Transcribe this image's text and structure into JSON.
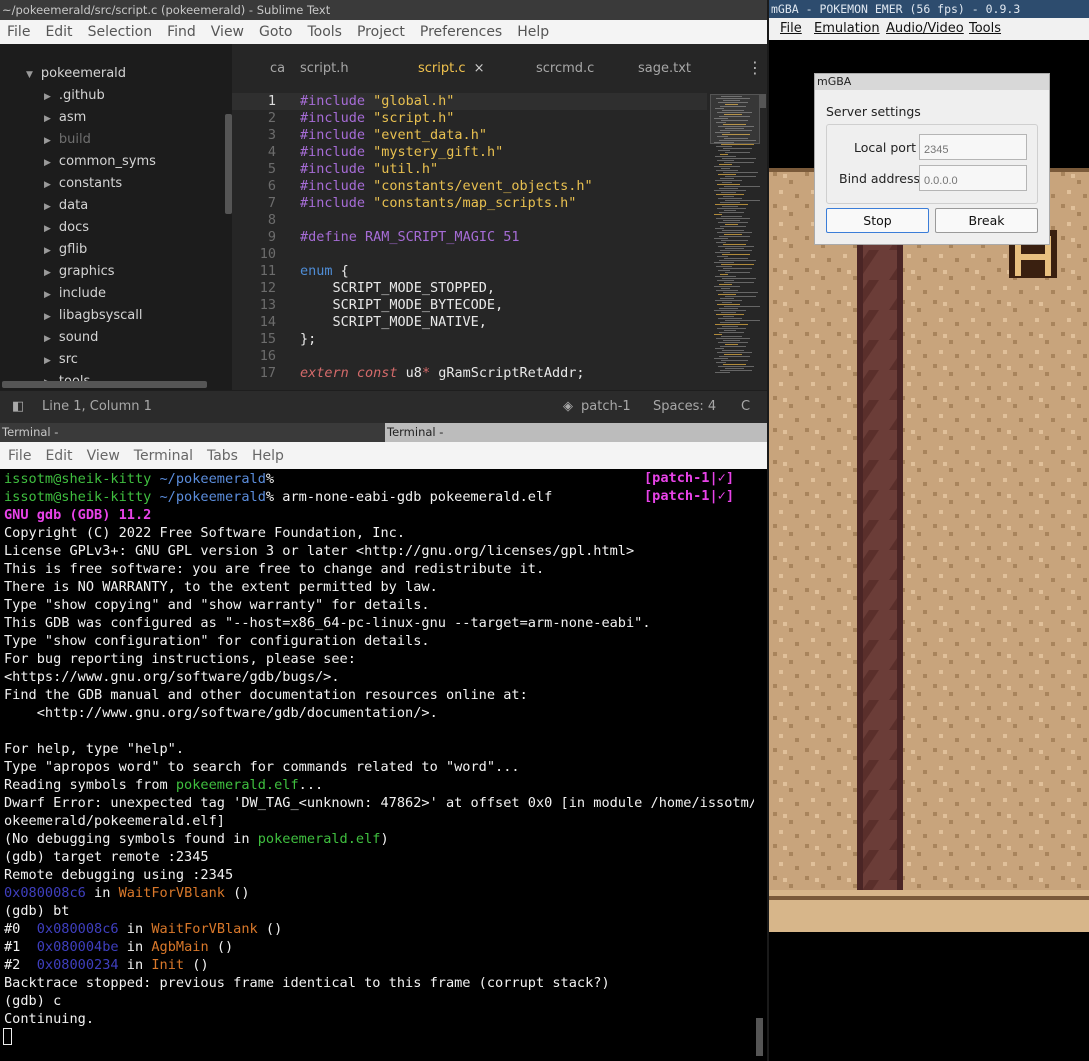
{
  "sublime": {
    "title": "~/pokeemerald/src/script.c (pokeemerald) - Sublime Text",
    "menu": [
      "File",
      "Edit",
      "Selection",
      "Find",
      "View",
      "Goto",
      "Tools",
      "Project",
      "Preferences",
      "Help"
    ],
    "sidebar": {
      "root": "pokeemerald",
      "folders": [
        ".github",
        "asm",
        "build",
        "common_syms",
        "constants",
        "data",
        "docs",
        "gflib",
        "graphics",
        "include",
        "libagbsyscall",
        "sound",
        "src",
        "tools"
      ]
    },
    "tabs": [
      "ca",
      "script.h",
      "script.c",
      "scrcmd.c",
      "sage.txt"
    ],
    "active_tab_close": "×",
    "code": [
      {
        "n": "1",
        "t": [
          [
            "kw",
            "#include "
          ],
          [
            "str",
            "\"global.h\""
          ]
        ]
      },
      {
        "n": "2",
        "t": [
          [
            "kw",
            "#include "
          ],
          [
            "str",
            "\"script.h\""
          ]
        ]
      },
      {
        "n": "3",
        "t": [
          [
            "kw",
            "#include "
          ],
          [
            "str",
            "\"event_data.h\""
          ]
        ]
      },
      {
        "n": "4",
        "t": [
          [
            "kw",
            "#include "
          ],
          [
            "str",
            "\"mystery_gift.h\""
          ]
        ]
      },
      {
        "n": "5",
        "t": [
          [
            "kw",
            "#include "
          ],
          [
            "str",
            "\"util.h\""
          ]
        ]
      },
      {
        "n": "6",
        "t": [
          [
            "kw",
            "#include "
          ],
          [
            "str",
            "\"constants/event_objects.h\""
          ]
        ]
      },
      {
        "n": "7",
        "t": [
          [
            "kw",
            "#include "
          ],
          [
            "str",
            "\"constants/map_scripts.h\""
          ]
        ]
      },
      {
        "n": "8",
        "t": []
      },
      {
        "n": "9",
        "t": [
          [
            "kw",
            "#define "
          ],
          [
            "num",
            "RAM_SCRIPT_MAGIC 51"
          ]
        ]
      },
      {
        "n": "10",
        "t": []
      },
      {
        "n": "11",
        "t": [
          [
            "enumkw",
            "enum "
          ],
          [
            "",
            "{"
          ]
        ]
      },
      {
        "n": "12",
        "t": [
          [
            "",
            "    SCRIPT_MODE_STOPPED,"
          ]
        ]
      },
      {
        "n": "13",
        "t": [
          [
            "",
            "    SCRIPT_MODE_BYTECODE,"
          ]
        ]
      },
      {
        "n": "14",
        "t": [
          [
            "",
            "    SCRIPT_MODE_NATIVE,"
          ]
        ]
      },
      {
        "n": "15",
        "t": [
          [
            "",
            "};"
          ]
        ]
      },
      {
        "n": "16",
        "t": []
      },
      {
        "n": "17",
        "t": [
          [
            "ital",
            "extern const "
          ],
          [
            "",
            "u8"
          ],
          [
            "ptr",
            "* "
          ],
          [
            "",
            "gRamScriptRetAddr;"
          ]
        ]
      }
    ],
    "status": {
      "position": "Line 1, Column 1",
      "branch": "patch-1",
      "spaces": "Spaces: 4",
      "syntax": "C"
    }
  },
  "terminal": {
    "title_left": "Terminal -",
    "title_right": "Terminal -",
    "menu": [
      "File",
      "Edit",
      "View",
      "Terminal",
      "Tabs",
      "Help"
    ],
    "lines": [
      [
        [
          "g",
          "issotm@sheik-kitty "
        ],
        [
          "b",
          "~/pokeemerald"
        ],
        [
          "",
          "%"
        ]
      ],
      [
        [
          "g",
          "issotm@sheik-kitty "
        ],
        [
          "b",
          "~/pokeemerald"
        ],
        [
          "",
          "% arm-none-eabi-gdb pokeemerald.elf"
        ]
      ],
      [
        [
          "mg",
          "GNU gdb (GDB) 11.2"
        ]
      ],
      [
        [
          "",
          "Copyright (C) 2022 Free Software Foundation, Inc."
        ]
      ],
      [
        [
          "",
          "License GPLv3+: GNU GPL version 3 or later <http://gnu.org/licenses/gpl.html>"
        ]
      ],
      [
        [
          "",
          "This is free software: you are free to change and redistribute it."
        ]
      ],
      [
        [
          "",
          "There is NO WARRANTY, to the extent permitted by law."
        ]
      ],
      [
        [
          "",
          "Type \"show copying\" and \"show warranty\" for details."
        ]
      ],
      [
        [
          "",
          "This GDB was configured as \"--host=x86_64-pc-linux-gnu --target=arm-none-eabi\"."
        ]
      ],
      [
        [
          "",
          "Type \"show configuration\" for configuration details."
        ]
      ],
      [
        [
          "",
          "For bug reporting instructions, please see:"
        ]
      ],
      [
        [
          "",
          "<https://www.gnu.org/software/gdb/bugs/>."
        ]
      ],
      [
        [
          "",
          "Find the GDB manual and other documentation resources online at:"
        ]
      ],
      [
        [
          "",
          "    <http://www.gnu.org/software/gdb/documentation/>."
        ]
      ],
      [],
      [
        [
          "",
          "For help, type \"help\"."
        ]
      ],
      [
        [
          "",
          "Type \"apropos word\" to search for commands related to \"word\"..."
        ]
      ],
      [
        [
          "",
          "Reading symbols from "
        ],
        [
          "g",
          "pokeemerald.elf"
        ],
        [
          "",
          "..."
        ]
      ],
      [
        [
          "",
          "Dwarf Error: unexpected tag 'DW_TAG_<unknown: 47862>' at offset 0x0 [in module /home/issotm/p"
        ]
      ],
      [
        [
          "",
          "okeemerald/pokeemerald.elf]"
        ]
      ],
      [
        [
          "",
          "(No debugging symbols found in "
        ],
        [
          "g",
          "pokeemerald.elf"
        ],
        [
          "",
          ")"
        ]
      ],
      [
        [
          "",
          "(gdb) target remote :2345"
        ]
      ],
      [
        [
          "",
          "Remote debugging using :2345"
        ]
      ],
      [
        [
          "dk",
          "0x080008c6"
        ],
        [
          "",
          " in "
        ],
        [
          "o",
          "WaitForVBlank"
        ],
        [
          "",
          " ()"
        ]
      ],
      [
        [
          "",
          "(gdb) bt"
        ]
      ],
      [
        [
          "",
          "#0  "
        ],
        [
          "dk",
          "0x080008c6"
        ],
        [
          "",
          " in "
        ],
        [
          "o",
          "WaitForVBlank"
        ],
        [
          "",
          " ()"
        ]
      ],
      [
        [
          "",
          "#1  "
        ],
        [
          "dk",
          "0x080004be"
        ],
        [
          "",
          " in "
        ],
        [
          "o",
          "AgbMain"
        ],
        [
          "",
          " ()"
        ]
      ],
      [
        [
          "",
          "#2  "
        ],
        [
          "dk",
          "0x08000234"
        ],
        [
          "",
          " in "
        ],
        [
          "o",
          "Init"
        ],
        [
          "",
          " ()"
        ]
      ],
      [
        [
          "",
          "Backtrace stopped: previous frame identical to this frame (corrupt stack?)"
        ]
      ],
      [
        [
          "",
          "(gdb) c"
        ]
      ],
      [
        [
          "",
          "Continuing."
        ]
      ]
    ],
    "rprompt": "[patch-1|✓]"
  },
  "mgba": {
    "title": "mGBA - POKEMON EMER (56 fps) - 0.9.3",
    "menu": [
      "File",
      "Emulation",
      "Audio/Video",
      "Tools"
    ],
    "dialog": {
      "title": "mGBA",
      "group": "Server settings",
      "port_label": "Local port",
      "port_placeholder": "2345",
      "bind_label": "Bind address",
      "bind_placeholder": "0.0.0.0",
      "stop": "Stop",
      "break": "Break"
    }
  }
}
